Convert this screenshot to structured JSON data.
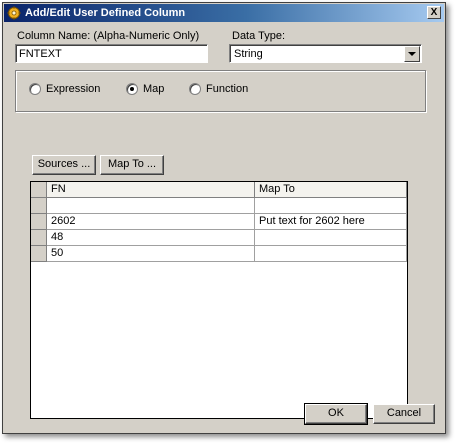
{
  "window": {
    "title": "Add/Edit User Defined Column",
    "close_glyph": "X"
  },
  "form": {
    "column_name_label": "Column Name:  (Alpha-Numeric Only)",
    "column_name_value": "FNTEXT",
    "data_type_label": "Data Type:",
    "data_type_value": "String"
  },
  "mode": {
    "options": [
      {
        "label": "Expression",
        "selected": false
      },
      {
        "label": "Map",
        "selected": true
      },
      {
        "label": "Function",
        "selected": false
      }
    ]
  },
  "toolbar": {
    "sources_label": "Sources ...",
    "map_to_label": "Map To ..."
  },
  "grid": {
    "columns": [
      "FN",
      "Map To"
    ],
    "rows": [
      {
        "fn": "",
        "map_to": ""
      },
      {
        "fn": "2602",
        "map_to": "Put text for 2602 here"
      },
      {
        "fn": "48",
        "map_to": ""
      },
      {
        "fn": "50",
        "map_to": ""
      }
    ]
  },
  "footer": {
    "ok_label": "OK",
    "cancel_label": "Cancel"
  },
  "colors": {
    "title_gradient_start": "#0a246a",
    "title_gradient_end": "#a6caf0",
    "dialog_face": "#d4d0c8"
  },
  "icons": {
    "title": "gear-icon",
    "close": "close-icon",
    "dropdown": "chevron-down-icon"
  }
}
